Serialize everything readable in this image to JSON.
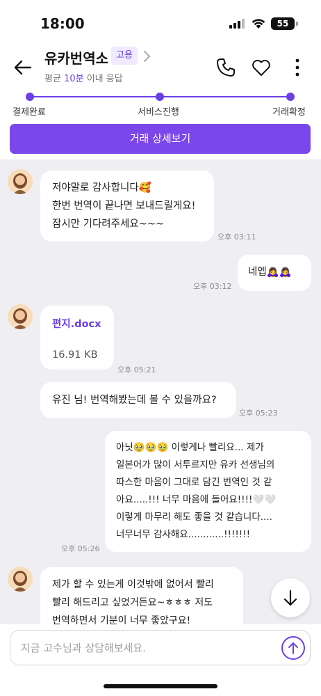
{
  "status_bar": {
    "time": "18:00",
    "battery": "55"
  },
  "header": {
    "title": "유카번역소",
    "badge": "고용",
    "subtitle_prefix": "평균 ",
    "subtitle_accent": "10분",
    "subtitle_suffix": " 이내 응답"
  },
  "progress": {
    "steps": [
      "결제완료",
      "서비스진행",
      "거래확정"
    ]
  },
  "detail_button": "거래 상세보기",
  "messages": [
    {
      "side": "left",
      "lines": [
        "저야말로 감사합니다🥰",
        "한번 번역이 끝나면 보내드릴게요!",
        "잠시만 기다려주세요~~~"
      ],
      "time": "오후 03:11"
    },
    {
      "side": "right",
      "lines": [
        "네엡🙇‍♀️🙇‍♀️"
      ],
      "time": "오후 03:12"
    },
    {
      "side": "left",
      "file_name": "편지.docx",
      "file_size": "16.91 KB",
      "time": "오후 05:21"
    },
    {
      "side": "left",
      "lines": [
        "유진 님! 번역해봤는데 볼 수 있을까요?"
      ],
      "time": "오후 05:23"
    },
    {
      "side": "right",
      "lines": [
        "아닛🥹🥹🥹 이렇게나 빨리요... 제가",
        "일본어가 많이 서투르지만 유카 선생님의",
        "따스한 마음이 그대로 담긴 번역인 것 같",
        "아요.....!!! 너무 마음에 들어요!!!!🤍🤍",
        "이렇게 마무리 해도 좋을 것 같습니다....",
        "너무너무 감사해요............!!!!!!!"
      ],
      "time": "오후 05:26"
    },
    {
      "side": "left",
      "lines": [
        "제가 할 수 있는게 이것밖에 없어서 빨리",
        "빨리 해드리고 싶었거든요~ㅎㅎㅎ 저도",
        "번역하면서 기분이 너무 좋았구요!"
      ]
    }
  ],
  "input": {
    "placeholder": "지금 고수님과 상담해보세요."
  },
  "colors": {
    "accent": "#6c3fe6",
    "button": "#7b47ea",
    "chat_bg": "#efeff3"
  }
}
